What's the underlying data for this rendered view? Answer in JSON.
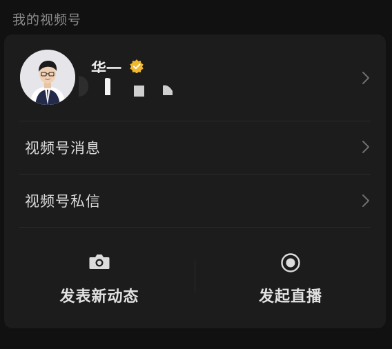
{
  "section": {
    "title": "我的视频号"
  },
  "profile": {
    "name": "华一",
    "verified_icon": "verified-badge-icon",
    "avatar_icon": "user-avatar",
    "chevron_icon": "chevron-right-icon"
  },
  "menu": {
    "items": [
      {
        "label": "视频号消息",
        "icon": "chevron-right-icon"
      },
      {
        "label": "视频号私信",
        "icon": "chevron-right-icon"
      }
    ]
  },
  "actions": {
    "post": {
      "label": "发表新动态",
      "icon": "camera-icon"
    },
    "live": {
      "label": "发起直播",
      "icon": "live-record-icon"
    }
  },
  "colors": {
    "background": "#111111",
    "card": "#1c1c1c",
    "verified": "#f0b72f",
    "text_primary": "#ececec",
    "text_secondary": "#8c8c8c"
  }
}
